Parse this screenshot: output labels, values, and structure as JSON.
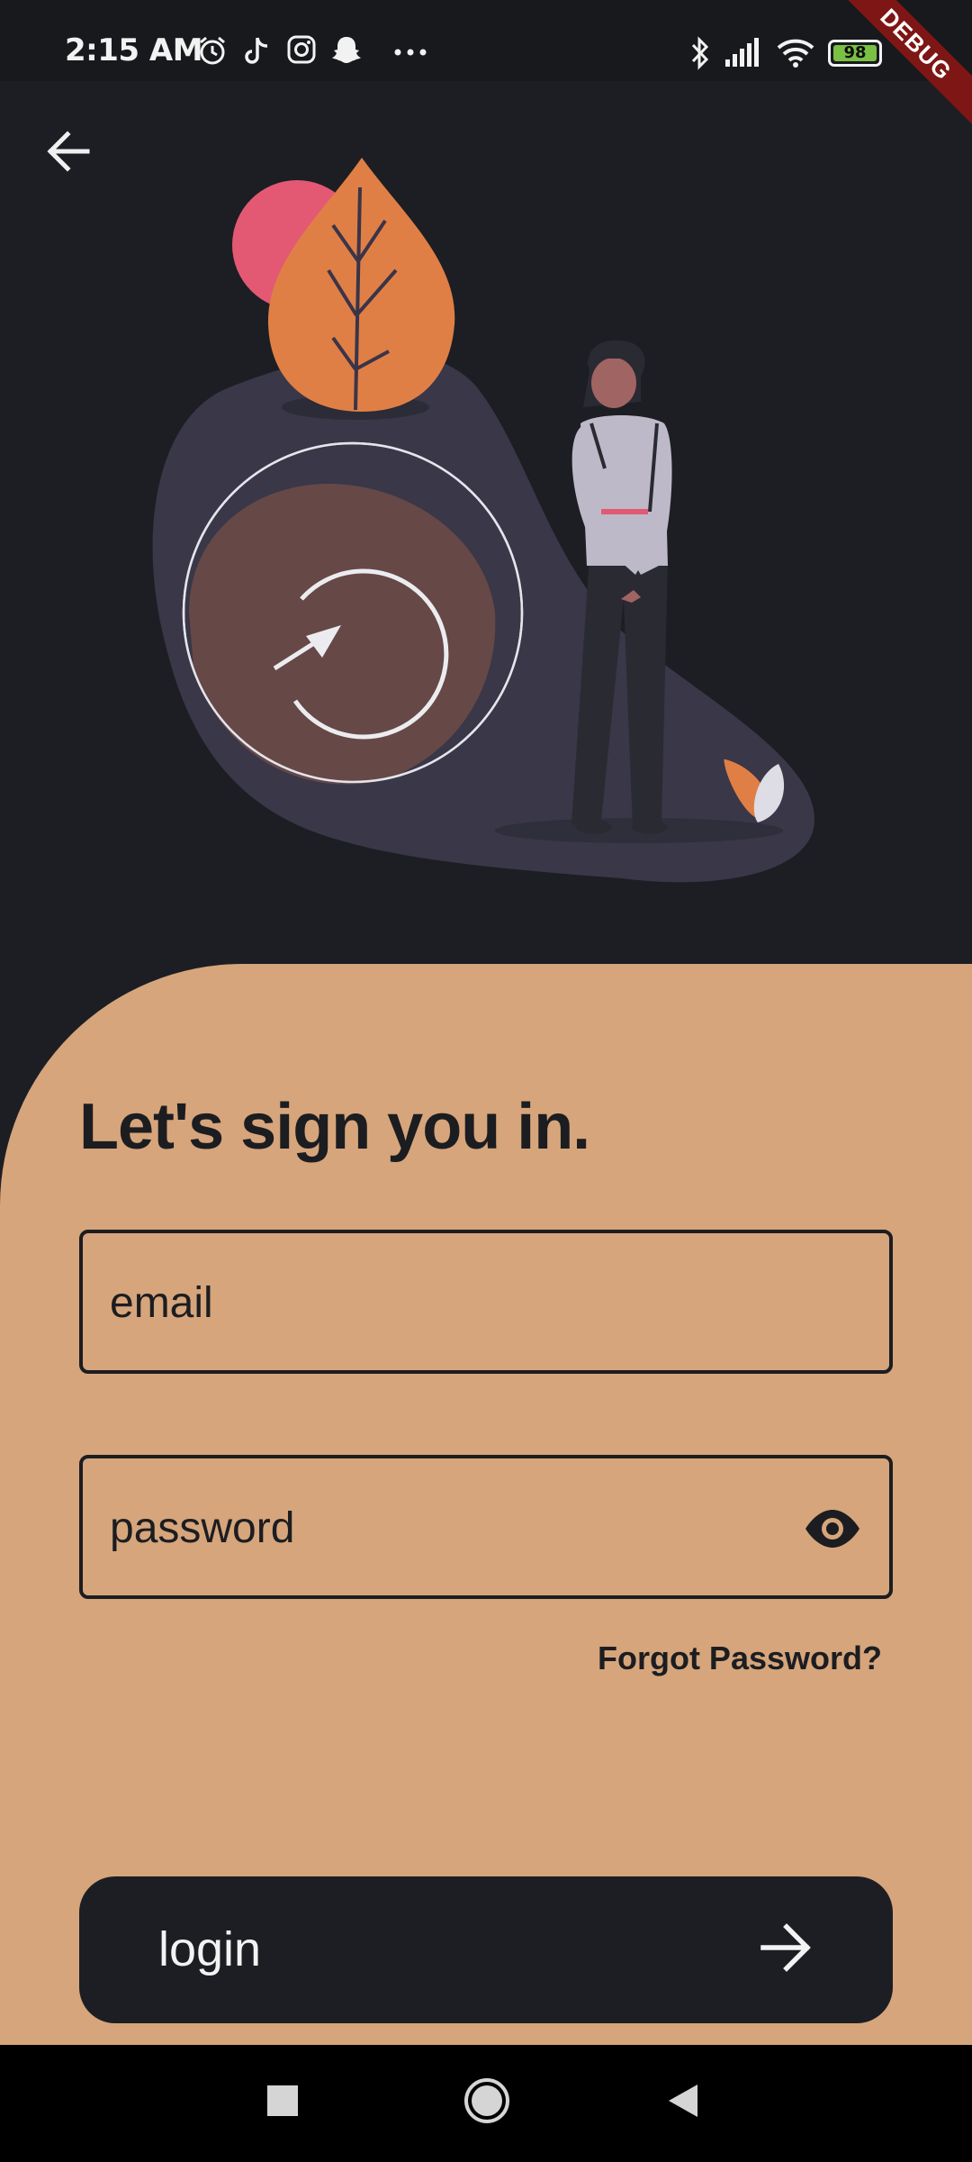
{
  "status_bar": {
    "time": "2:15 AM",
    "battery_level": "98",
    "left_icons": [
      "alarm-icon",
      "tiktok-icon",
      "instagram-icon",
      "snapchat-icon",
      "more-dots-icon"
    ],
    "right_icons": [
      "bluetooth-icon",
      "signal-icon",
      "wifi-icon",
      "battery-icon"
    ]
  },
  "debug_banner": "DEBUG",
  "colors": {
    "background": "#1c1e24",
    "panel": "#d6a57b",
    "text_dark": "#1c1d21",
    "accent_orange": "#e07f45",
    "accent_pink": "#e35973"
  },
  "header": {
    "back_icon": "arrow-left-icon"
  },
  "login": {
    "heading": "Let's sign you in.",
    "email_placeholder": "email",
    "password_placeholder": "password",
    "password_toggle_icon": "eye-icon",
    "forgot_password": "Forgot Password?",
    "login_label": "login",
    "login_icon": "arrow-right-icon"
  },
  "nav_bar": {
    "icons": [
      "recents-square-icon",
      "home-circle-icon",
      "back-triangle-icon"
    ]
  }
}
